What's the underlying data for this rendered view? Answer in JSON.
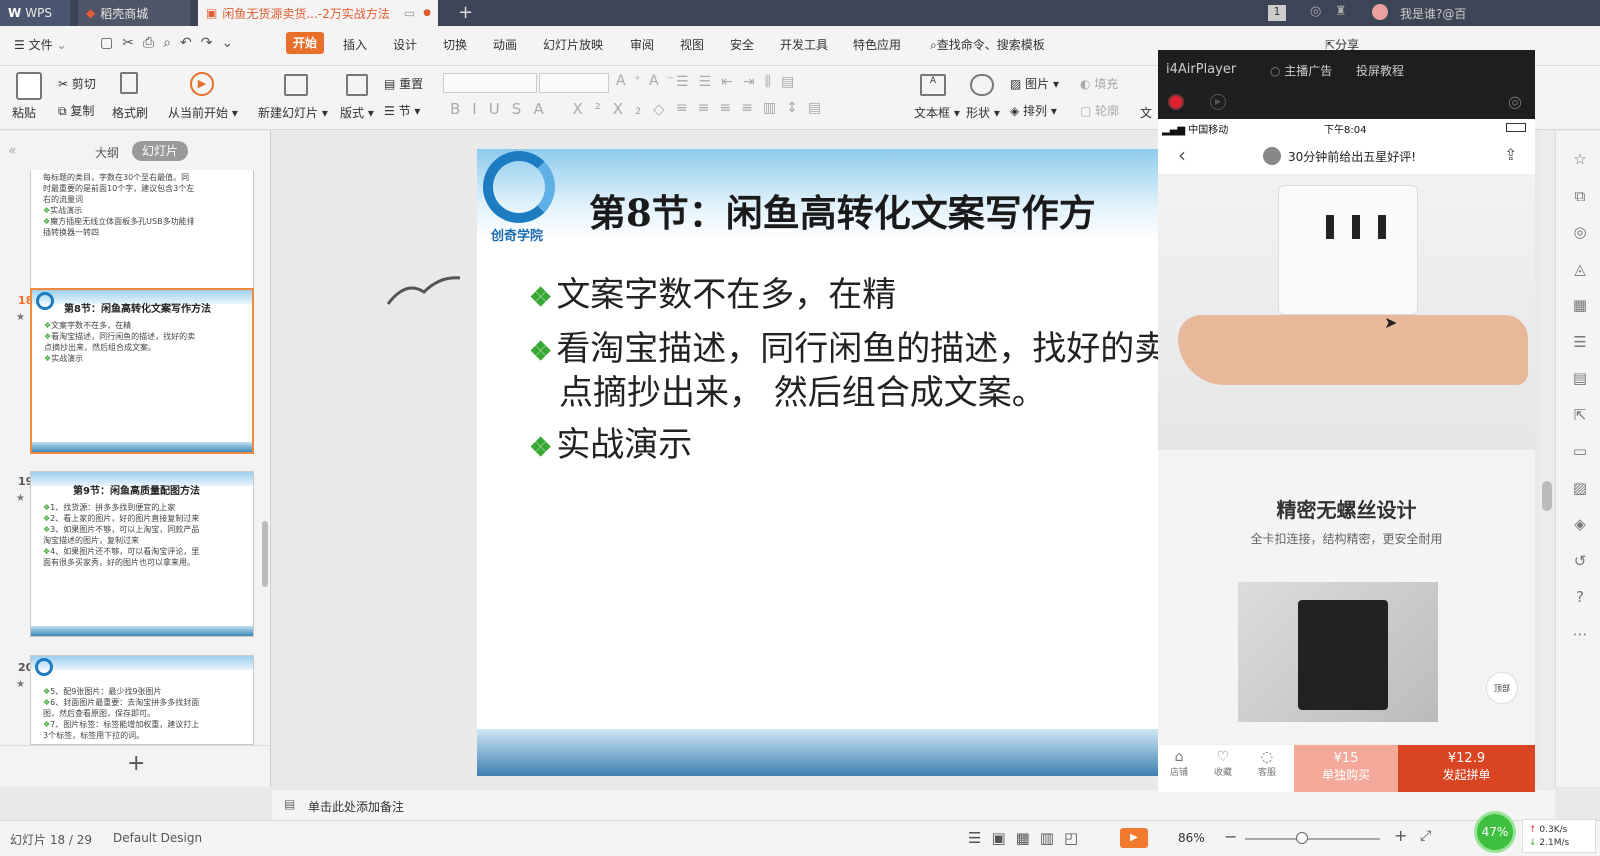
{
  "tabs": [
    {
      "label": "WPS"
    },
    {
      "label": "稻壳商城"
    },
    {
      "label": "闲鱼无货源卖货...-2万实战方法"
    }
  ],
  "titlebar_right": {
    "badge": "1",
    "user": "我是谁?@百"
  },
  "menu": {
    "file": "文件",
    "items": [
      "开始",
      "插入",
      "设计",
      "切换",
      "动画",
      "幻灯片放映",
      "审阅",
      "视图",
      "安全",
      "开发工具",
      "特色应用"
    ],
    "search": "查找命令、搜索模板",
    "share": "分享"
  },
  "ribbon": {
    "paste": "粘贴",
    "cut": "剪切",
    "copy": "复制",
    "format_painter": "格式刷",
    "from_current": "从当前开始",
    "new_slide": "新建幻灯片",
    "layout": "版式",
    "reset": "重置",
    "section": "节",
    "textbox": "文本框",
    "shape": "形状",
    "picture": "图片",
    "arrange": "排列",
    "fill": "填充",
    "outline": "轮廓",
    "text_more": "文"
  },
  "panel": {
    "tab_outline": "大纲",
    "tab_slides": "幻灯片",
    "add_icon": "+"
  },
  "thumbs": [
    {
      "num": "",
      "lines": [
        "每标题的类目，字数在30个至右最值。同",
        "时最重要的是前面10个字，建议包含3个左",
        "右的流量词",
        "实战演示",
        "魔方插座无线立体面板多孔USB多功能排",
        "插转换器一转四"
      ]
    },
    {
      "num": "18",
      "title": "第8节：闲鱼高转化文案写作方法",
      "lines": [
        "文案字数不在多，在精",
        "看淘宝描述，同行闲鱼的描述，找好的卖",
        "点摘抄出来，然后组合成文案。",
        "实战演示"
      ]
    },
    {
      "num": "19",
      "title": "第9节：闲鱼高质量配图方法",
      "lines": [
        "1、找货源：拼多多找到便宜的上家",
        "2、看上家的图片，好的图片直接复制过来",
        "3、如果图片不够，可以上淘宝，同款产品",
        "淘宝描述的图片，复制过来",
        "4、如果图片还不够，可以看淘宝评论，里",
        "面有很多买家秀，好的图片也可以拿来用。"
      ]
    },
    {
      "num": "20",
      "lines": [
        "5、配9张图片：最少找9张图片",
        "6、封面图片最重要：去淘宝拼多多找封面",
        "图，然后查看原图，保存即可。",
        "7、图片标签：标签能增加权重，建议打上",
        "3个标签，标签用下拉的词。"
      ]
    }
  ],
  "slide": {
    "logo_text": "创奇学院",
    "title": "第8节：闲鱼高转化文案写作方",
    "bullets": [
      "文案字数不在多，在精",
      "看淘宝描述，同行闲鱼的描述，找好的卖",
      "点摘抄出来， 然后组合成文案。",
      "实战演示"
    ]
  },
  "player": {
    "app": "i4AirPlayer",
    "ads": "主播广告",
    "tutorial": "投屏教程"
  },
  "phone": {
    "carrier": "中国移动",
    "time": "下午8:04",
    "review": "30分钟前给出五星好评!",
    "design_title": "精密无螺丝设计",
    "design_sub": "全卡扣连接，结构精密，更安全耐用",
    "top_btn": "顶部",
    "nav": [
      "店铺",
      "收藏",
      "客服"
    ],
    "solo_price": "¥15",
    "solo_label": "单独购买",
    "group_price": "¥12.9",
    "group_label": "发起拼单"
  },
  "notes": {
    "placeholder": "单击此处添加备注"
  },
  "status": {
    "slide_info": "幻灯片 18 / 29",
    "theme": "Default Design",
    "zoom": "86%",
    "cpu": "47%",
    "up": "0.3K/s",
    "down": "2.1M/s"
  },
  "colors": {
    "accent": "#e05d2e",
    "green": "#3aa835",
    "group": "#d94422",
    "solo": "#f3a89a"
  }
}
